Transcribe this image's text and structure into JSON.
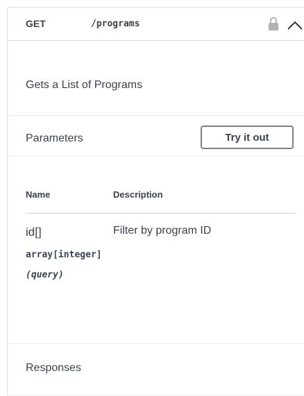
{
  "summary": {
    "method": "GET",
    "path": "/programs",
    "lock_icon": "lock-icon",
    "collapse_icon": "chevron-up-icon"
  },
  "description": "Gets a List of Programs",
  "parameters": {
    "title": "Parameters",
    "try_button": "Try it out",
    "columns": {
      "name": "Name",
      "description": "Description"
    },
    "items": [
      {
        "name": "id[]",
        "type": "array[integer]",
        "in": "(query)",
        "description": "Filter by program ID"
      }
    ]
  },
  "responses": {
    "title": "Responses"
  },
  "colors": {
    "text": "#3b4151",
    "border": "#d8dde7",
    "button_border": "#808080",
    "lock": "#b3b3b3"
  }
}
